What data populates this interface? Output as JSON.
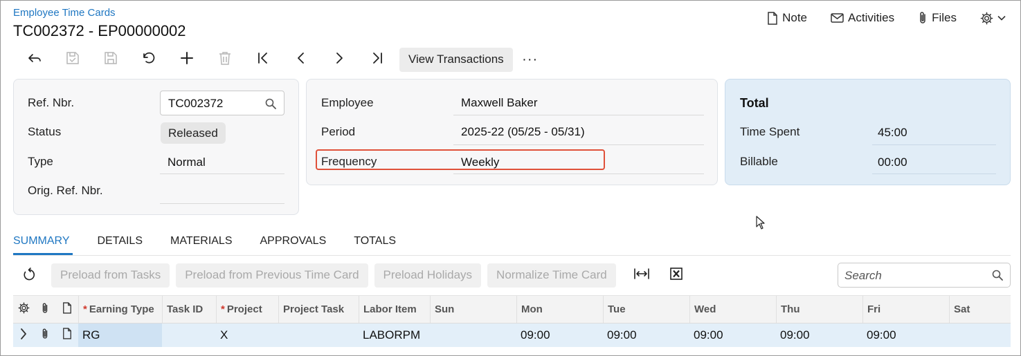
{
  "header": {
    "breadcrumb": "Employee Time Cards",
    "title": "TC002372 - EP00000002",
    "actions": [
      {
        "label": "Note",
        "icon": "note-icon"
      },
      {
        "label": "Activities",
        "icon": "mail-icon"
      },
      {
        "label": "Files",
        "icon": "paperclip-icon"
      }
    ],
    "settings_icon": "gear-icon"
  },
  "toolbar": {
    "buttons": [
      "back-icon",
      "save-close-icon",
      "save-icon",
      "undo-icon",
      "add-icon",
      "delete-icon",
      "first-icon",
      "prev-icon",
      "next-icon",
      "last-icon"
    ],
    "view_transactions": "View Transactions",
    "more": "···"
  },
  "summary": {
    "ref_nbr_label": "Ref. Nbr.",
    "ref_nbr_value": "TC002372",
    "status_label": "Status",
    "status_value": "Released",
    "type_label": "Type",
    "type_value": "Normal",
    "orig_ref_label": "Orig. Ref. Nbr.",
    "orig_ref_value": ""
  },
  "employee": {
    "employee_label": "Employee",
    "employee_value": "Maxwell Baker",
    "period_label": "Period",
    "period_value": "2025-22 (05/25 - 05/31)",
    "frequency_label": "Frequency",
    "frequency_value": "Weekly"
  },
  "totals": {
    "title": "Total",
    "time_spent_label": "Time Spent",
    "time_spent_value": "45:00",
    "billable_label": "Billable",
    "billable_value": "00:00",
    "bg_color": "#e1edf7"
  },
  "tabs": [
    "SUMMARY",
    "DETAILS",
    "MATERIALS",
    "APPROVALS",
    "TOTALS"
  ],
  "active_tab": "SUMMARY",
  "grid_toolbar": {
    "buttons": [
      "Preload from Tasks",
      "Preload from Previous Time Card",
      "Preload Holidays",
      "Normalize Time Card"
    ],
    "search_placeholder": "Search"
  },
  "grid": {
    "columns": [
      "Earning Type",
      "Task ID",
      "Project",
      "Project Task",
      "Labor Item",
      "Sun",
      "Mon",
      "Tue",
      "Wed",
      "Thu",
      "Fri",
      "Sat"
    ],
    "required_columns": [
      "Earning Type",
      "Project"
    ],
    "rows": [
      {
        "earning_type": "RG",
        "task_id": "",
        "project": "X",
        "project_task": "",
        "labor_item": "LABORPM",
        "sun": "",
        "mon": "09:00",
        "tue": "09:00",
        "wed": "09:00",
        "thu": "09:00",
        "fri": "09:00",
        "sat": ""
      }
    ]
  },
  "colors": {
    "accent": "#1f77c2",
    "highlight_border": "#e0513a"
  }
}
